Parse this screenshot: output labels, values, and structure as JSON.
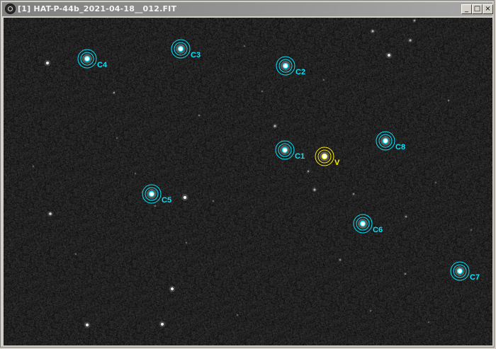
{
  "window": {
    "title": "[1] HAT-P-44b_2021-04-18__012.FIT",
    "controls": {
      "minimize": "_",
      "maximize": "□",
      "close": "×"
    }
  },
  "colors": {
    "comparison": "#00e5ff",
    "variable": "#ffee00",
    "background": "#2e2e2e"
  },
  "markers": [
    {
      "label": "C4",
      "type": "comparison"
    },
    {
      "label": "C3",
      "type": "comparison"
    },
    {
      "label": "C2",
      "type": "comparison"
    },
    {
      "label": "C1",
      "type": "comparison"
    },
    {
      "label": "V",
      "type": "variable"
    },
    {
      "label": "C8",
      "type": "comparison"
    },
    {
      "label": "C5",
      "type": "comparison"
    },
    {
      "label": "C6",
      "type": "comparison"
    },
    {
      "label": "C7",
      "type": "comparison"
    }
  ]
}
